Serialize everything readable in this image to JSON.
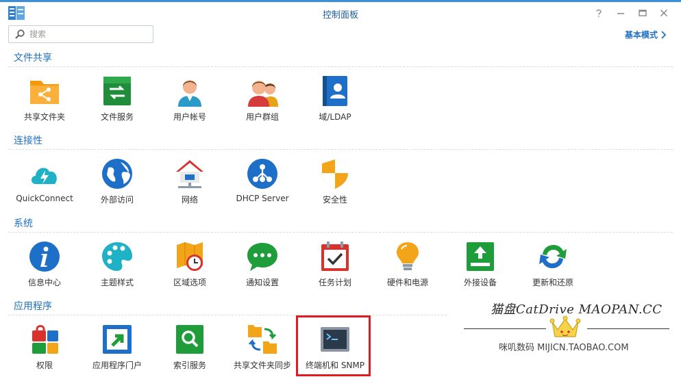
{
  "window": {
    "title": "控制面板",
    "accent": "#3b8fd6"
  },
  "search": {
    "placeholder": "搜索",
    "value": ""
  },
  "mode_link": {
    "label": "基本模式"
  },
  "sections": [
    {
      "title": "文件共享",
      "items": [
        {
          "label": "共享文件夹",
          "icon": "shared-folder-icon"
        },
        {
          "label": "文件服务",
          "icon": "file-services-icon"
        },
        {
          "label": "用户帐号",
          "icon": "user-icon"
        },
        {
          "label": "用户群组",
          "icon": "group-icon"
        },
        {
          "label": "域/LDAP",
          "icon": "domain-ldap-icon"
        }
      ]
    },
    {
      "title": "连接性",
      "items": [
        {
          "label": "QuickConnect",
          "icon": "quickconnect-icon"
        },
        {
          "label": "外部访问",
          "icon": "external-access-icon"
        },
        {
          "label": "网络",
          "icon": "network-icon"
        },
        {
          "label": "DHCP Server",
          "icon": "dhcp-server-icon"
        },
        {
          "label": "安全性",
          "icon": "security-shield-icon"
        }
      ]
    },
    {
      "title": "系统",
      "items": [
        {
          "label": "信息中心",
          "icon": "info-center-icon"
        },
        {
          "label": "主题样式",
          "icon": "theme-palette-icon"
        },
        {
          "label": "区域选项",
          "icon": "regional-options-icon"
        },
        {
          "label": "通知设置",
          "icon": "notification-icon"
        },
        {
          "label": "任务计划",
          "icon": "task-scheduler-icon"
        },
        {
          "label": "硬件和电源",
          "icon": "hardware-power-icon"
        },
        {
          "label": "外接设备",
          "icon": "external-devices-icon"
        },
        {
          "label": "更新和还原",
          "icon": "update-restore-icon"
        }
      ]
    },
    {
      "title": "应用程序",
      "items": [
        {
          "label": "权限",
          "icon": "privileges-icon"
        },
        {
          "label": "应用程序门户",
          "icon": "application-portal-icon"
        },
        {
          "label": "索引服务",
          "icon": "indexing-service-icon"
        },
        {
          "label": "共享文件夹同步",
          "icon": "shared-folder-sync-icon"
        },
        {
          "label": "终端机和 SNMP",
          "icon": "terminal-snmp-icon"
        }
      ]
    }
  ],
  "promo": {
    "brand": "猫盘CatDrive MAOPAN.CC",
    "shop": "咪叽数码 MIJICN.TAOBAO.COM"
  }
}
